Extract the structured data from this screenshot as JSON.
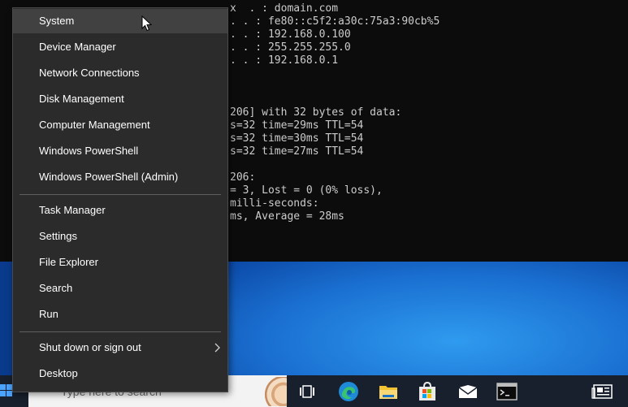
{
  "console": {
    "lines": [
      "x  . : domain.com",
      ". . : fe80::c5f2:a30c:75a3:90cb%5",
      ". . : 192.168.0.100",
      ". . : 255.255.255.0",
      ". . : 192.168.0.1",
      "206] with 32 bytes of data:",
      "s=32 time=29ms TTL=54",
      "s=32 time=30ms TTL=54",
      "s=32 time=27ms TTL=54",
      "206:",
      "= 3, Lost = 0 (0% loss),",
      "milli-seconds:",
      "ms, Average = 28ms"
    ]
  },
  "menu": {
    "group1": [
      "System",
      "Device Manager",
      "Network Connections",
      "Disk Management",
      "Computer Management",
      "Windows PowerShell",
      "Windows PowerShell (Admin)"
    ],
    "group2": [
      "Task Manager",
      "Settings",
      "File Explorer",
      "Search",
      "Run"
    ],
    "group3": [
      "Shut down or sign out",
      "Desktop"
    ]
  },
  "taskbar": {
    "search_placeholder": "Type here to search",
    "icons": [
      "task-view-icon",
      "edge-icon",
      "file-explorer-icon",
      "store-icon",
      "mail-icon",
      "terminal-icon",
      "news-icon"
    ]
  },
  "colors": {
    "menu_bg": "#2b2b2b",
    "highlight": "#414141",
    "taskbar": "#17202c",
    "accent": "#0078d4"
  }
}
